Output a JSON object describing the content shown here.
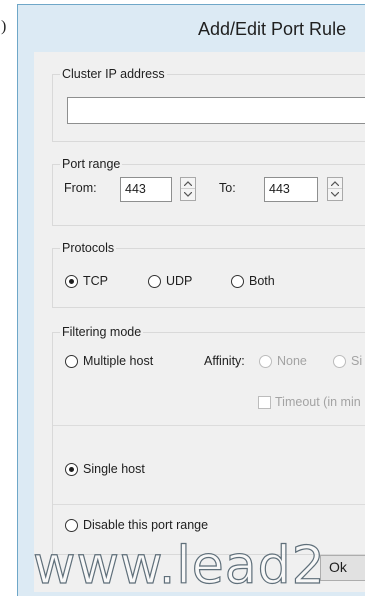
{
  "edge_label": ")",
  "window": {
    "title": "Add/Edit Port Rule"
  },
  "cluster_ip": {
    "label": "Cluster IP address",
    "value": ""
  },
  "port_range": {
    "label": "Port range",
    "from_label": "From:",
    "from_value": "443",
    "to_label": "To:",
    "to_value": "443"
  },
  "protocols": {
    "label": "Protocols",
    "options": [
      "TCP",
      "UDP",
      "Both"
    ],
    "selected": "TCP"
  },
  "filtering": {
    "label": "Filtering mode",
    "multiple_host": "Multiple host",
    "affinity_label": "Affinity:",
    "affinity_none": "None",
    "affinity_second": "Si",
    "timeout_label": "Timeout (in min",
    "single_host": "Single host",
    "selected": "Single host"
  },
  "disable": {
    "label": "Disable this port range"
  },
  "watermark": "www.lead2",
  "corner_button_label": "Ok"
}
